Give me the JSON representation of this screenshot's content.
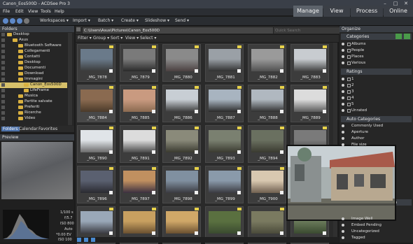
{
  "window": {
    "title": "Canon_Eos500D - ACDSee Pro 3",
    "controls": [
      "–",
      "□",
      "✕"
    ]
  },
  "menu": [
    "File",
    "Edit",
    "View",
    "Tools",
    "Help"
  ],
  "modes": [
    {
      "label": "Manage",
      "active": true
    },
    {
      "label": "View",
      "active": false
    },
    {
      "label": "Process",
      "active": false
    },
    {
      "label": "Online",
      "active": false
    }
  ],
  "toolbar": {
    "items": [
      "Workspaces ▾",
      "Import ▾",
      "Batch ▾",
      "Create ▾",
      "Slideshow ▾",
      "Send ▾"
    ]
  },
  "folders": {
    "title": "Folders",
    "items": [
      {
        "label": "Desktop",
        "indent": 0
      },
      {
        "label": "Asus",
        "indent": 1
      },
      {
        "label": "Bluetooth Software",
        "indent": 2
      },
      {
        "label": "Collegamenti",
        "indent": 2
      },
      {
        "label": "Contatti",
        "indent": 2
      },
      {
        "label": "Desktop",
        "indent": 2
      },
      {
        "label": "Documenti",
        "indent": 2
      },
      {
        "label": "Download",
        "indent": 2
      },
      {
        "label": "Immagini",
        "indent": 2
      },
      {
        "label": "Canon_Eos500D",
        "indent": 3,
        "selected": true
      },
      {
        "label": "LifeFrame",
        "indent": 3
      },
      {
        "label": "Musica",
        "indent": 2
      },
      {
        "label": "Partite salvate",
        "indent": 2
      },
      {
        "label": "Preferiti",
        "indent": 2
      },
      {
        "label": "Ricerche",
        "indent": 2
      },
      {
        "label": "Video",
        "indent": 2
      }
    ],
    "tabs": [
      "Folders",
      "Calendar",
      "Favorites"
    ]
  },
  "preview": {
    "title": "Preview",
    "info": [
      "1/100 s",
      "f/5.7",
      "ISO 800",
      "Auto",
      "*0.00 EV",
      "ISO 100"
    ]
  },
  "path": {
    "value": "C:\\Users\\Asus\\Pictures\\Canon_Eos500D",
    "search_placeholder": "Quick Search"
  },
  "filters": [
    "Filter ▾",
    "Group ▾",
    "Sort ▾",
    "View ▾",
    "Select ▾"
  ],
  "thumbs": [
    {
      "cap": "_MG_7878",
      "c1": "#6a7a8a",
      "c2": "#3a3a3a"
    },
    {
      "cap": "_MG_7879",
      "c1": "#7a7a7a",
      "c2": "#2a2a2a"
    },
    {
      "cap": "_MG_7880",
      "c1": "#8a8a8a",
      "c2": "#4a4040"
    },
    {
      "cap": "_MG_7881",
      "c1": "#9aa0a6",
      "c2": "#303030"
    },
    {
      "cap": "_MG_7882",
      "c1": "#9a9a9a",
      "c2": "#505050"
    },
    {
      "cap": "_MG_7883",
      "c1": "#c8ccd0",
      "c2": "#404040"
    },
    {
      "cap": "_MG_7884",
      "c1": "#8a6a50",
      "c2": "#4a3a2a"
    },
    {
      "cap": "_MG_7885",
      "c1": "#c99a80",
      "c2": "#8a6a50"
    },
    {
      "cap": "_MG_7886",
      "c1": "#c8ced4",
      "c2": "#3a3a3a"
    },
    {
      "cap": "_MG_7887",
      "c1": "#a8b4c0",
      "c2": "#2a2a2a"
    },
    {
      "cap": "_MG_7888",
      "c1": "#b0b8c0",
      "c2": "#303030"
    },
    {
      "cap": "_MG_7889",
      "c1": "#dcdcdc",
      "c2": "#5a5a5a"
    },
    {
      "cap": "_MG_7890",
      "c1": "#e0e4e8",
      "c2": "#6a6a6a"
    },
    {
      "cap": "_MG_7891",
      "c1": "#dcdcdc",
      "c2": "#4a4a4a"
    },
    {
      "cap": "_MG_7892",
      "c1": "#8a8a7a",
      "c2": "#3a3a30"
    },
    {
      "cap": "_MG_7893",
      "c1": "#7a8070",
      "c2": "#3a3a30"
    },
    {
      "cap": "_MG_7894",
      "c1": "#6a7060",
      "c2": "#3a3a30"
    },
    {
      "cap": "_MG_7895",
      "c1": "#7a7a7a",
      "c2": "#3a3a3a"
    },
    {
      "cap": "_MG_7896",
      "c1": "#5a6070",
      "c2": "#2a2a30"
    },
    {
      "cap": "_MG_7897",
      "c1": "#c09060",
      "c2": "#3a3040"
    },
    {
      "cap": "_MG_7898",
      "c1": "#8090a0",
      "c2": "#3a3a40"
    },
    {
      "cap": "_MG_7899",
      "c1": "#8a9aaa",
      "c2": "#3a3a40"
    },
    {
      "cap": "_MG_7900",
      "c1": "#d8c8b0",
      "c2": "#706050"
    },
    {
      "cap": "_MG_7901",
      "c1": "#8090a0",
      "c2": "#4a4a50"
    },
    {
      "cap": "",
      "c1": "#9aa8b8",
      "c2": "#3a3a40"
    },
    {
      "cap": "",
      "c1": "#c8a060",
      "c2": "#6a5030"
    },
    {
      "cap": "",
      "c1": "#d0a868",
      "c2": "#6a5030"
    },
    {
      "cap": "",
      "c1": "#5a7040",
      "c2": "#3a4a30"
    },
    {
      "cap": "",
      "c1": "#7a7a60",
      "c2": "#4a4a3a"
    },
    {
      "cap": "",
      "c1": "#6a7a5a",
      "c2": "#3a4a30"
    }
  ],
  "organize": {
    "title": "Organize",
    "categories_title": "Categories",
    "categories": [
      "Albums",
      "People",
      "Places",
      "Various"
    ],
    "ratings_title": "Ratings",
    "ratings": [
      "1",
      "2",
      "3",
      "4",
      "5",
      "Unrated"
    ],
    "auto_title": "Auto Categories",
    "auto": [
      "Commonly Used",
      "Aperture",
      "Author",
      "File size"
    ],
    "special": [
      "Image Well",
      "Embed Pending",
      "Uncategorized",
      "Tagged"
    ],
    "search_title": "ch"
  },
  "statusbar": {
    "icons": [
      "export-icon",
      "share-icon",
      "settings-icon"
    ]
  }
}
